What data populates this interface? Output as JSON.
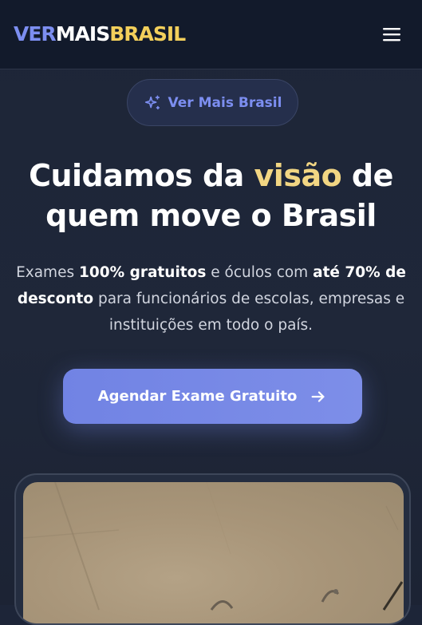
{
  "header": {
    "logo": {
      "part1": "VER",
      "part2": "MAIS",
      "part3": "BRASIL"
    },
    "menu_icon": "hamburger-menu-icon"
  },
  "badge": {
    "label": "Ver Mais Brasil",
    "icon": "sparkles-icon"
  },
  "hero": {
    "headline_before": "Cuidamos da ",
    "headline_highlight": "visão",
    "headline_after": " de quem move o Brasil",
    "desc": {
      "t1": "Exames ",
      "b1": "100% gratuitos",
      "t2": " e óculos com ",
      "b2": "até 70% de desconto",
      "t3": " para funcionários de escolas, empresas e instituições em todo o país."
    },
    "cta_label": "Agendar Exame Gratuito",
    "cta_icon": "arrow-right-icon"
  },
  "colors": {
    "accent": "#7c8ef0",
    "logo_yellow": "#f2cf5b",
    "highlight": "#f2d683",
    "header_bg": "#121a2b",
    "page_bg": "#1f2739"
  }
}
